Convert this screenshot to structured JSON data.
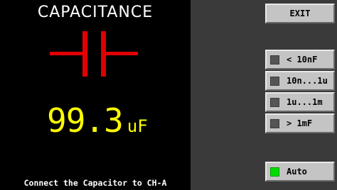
{
  "display": {
    "title": "CAPACITANCE",
    "value": "99.3",
    "unit": "uF",
    "message": "Connect the Capacitor to CH-A",
    "symbol": "capacitor-symbol-icon"
  },
  "buttons": {
    "exit": "EXIT",
    "ranges": [
      {
        "label": "< 10nF",
        "active": false
      },
      {
        "label": "10n...1u",
        "active": false
      },
      {
        "label": "1u...1m",
        "active": false
      },
      {
        "label": "> 1mF",
        "active": false
      }
    ],
    "auto": {
      "label": "Auto",
      "active": true
    }
  },
  "colors": {
    "reading": "#ffff00",
    "symbol": "#e00000",
    "indicator_on": "#00dd00",
    "indicator_off": "#555555",
    "display_background": "#000000",
    "panel_background": "#3a3a3a",
    "button_face": "#c4c4c4"
  }
}
